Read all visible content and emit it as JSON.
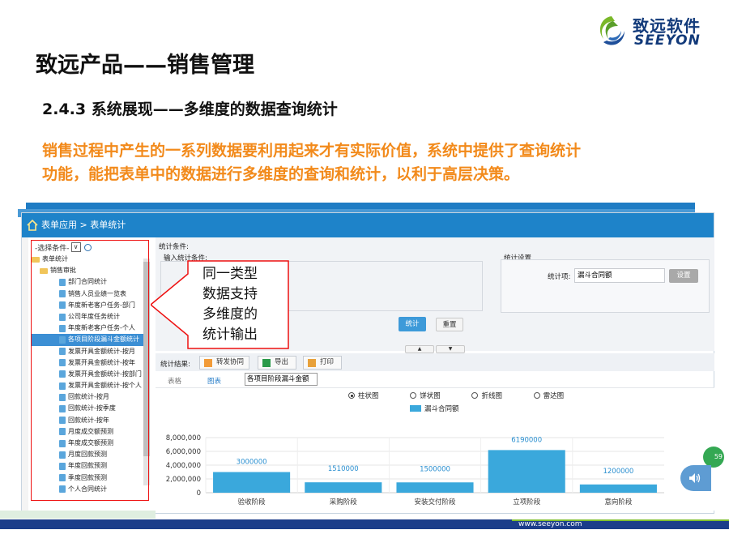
{
  "brand": {
    "cn": "致远软件",
    "en": "SEEYON",
    "url": "www.seeyon.com"
  },
  "slide": {
    "title": "致远产品——销售管理",
    "subtitle": "2.4.3 系统展现——多维度的数据查询统计",
    "desc_line1": "销售过程中产生的一系列数据要利用起来才有实际价值，系统中提供了查询统计",
    "desc_line2": "功能，能把表单中的数据进行多维度的查询和统计，以利于高层决策。"
  },
  "callout": {
    "line1": "同一类型",
    "line2": "数据支持",
    "line3": "多维度的",
    "line4": "统计输出"
  },
  "window": {
    "breadcrumb": "表单应用 > 表单统计",
    "tree": {
      "filter_label": "选择条件",
      "select_value": "∨",
      "root": "表单统计",
      "group": "销售审批",
      "items": [
        "部门合同统计",
        "销售人员业绩一览表",
        "年度新老客户任务-部门",
        "公司年度任务统计",
        "年度新老客户任务-个人",
        "各项目阶段漏斗金额统计",
        "发票开具金额统计-按月",
        "发票开具金额统计-按年",
        "发票开具金额统计-按部门",
        "发票开具金额统计-按个人",
        "回款统计-按月",
        "回款统计-按季度",
        "回款统计-按年",
        "月度成交额预测",
        "年度成交额预测",
        "月度回款预测",
        "年度回款预测",
        "季度回款预测",
        "个人合同统计"
      ]
    },
    "conditions": {
      "title": "统计条件:",
      "input_label": "输入统计条件:",
      "settings_title": "统计设置",
      "stat_item_label": "统计项:",
      "stat_item_value": "漏斗合同额",
      "settings_button": "设置",
      "stat_button": "统计",
      "reset_button": "重置",
      "collapse_up": "▲",
      "collapse_down": "▼"
    },
    "results": {
      "label": "统计结果:",
      "forward_button": "转发协同",
      "export_button": "导出",
      "print_button": "打印",
      "tab_table": "表格",
      "tab_chart": "图表",
      "report_select": "各项目阶段漏斗金额",
      "chart_types": [
        "柱状图",
        "饼状图",
        "折线图",
        "雷达图"
      ],
      "chart_type_selected": "柱状图"
    }
  },
  "badge_text": "59",
  "chart_data": {
    "type": "bar",
    "categories": [
      "验收阶段",
      "采购阶段",
      "安装交付阶段",
      "立项阶段",
      "意向阶段"
    ],
    "series": [
      {
        "name": "漏斗合同额",
        "values": [
          3000000,
          1510000,
          1500000,
          6190000,
          1200000
        ],
        "labels": [
          "3000000",
          "1510000",
          "1500000",
          "6190000",
          "1200000"
        ]
      }
    ],
    "yticks": [
      "0",
      "2,000,000",
      "4,000,000",
      "6,000,000",
      "8,000,000"
    ],
    "ylim": [
      0,
      8000000
    ],
    "legend": "top-center",
    "grid": true,
    "colors": {
      "bar": "#3aa8dc",
      "label": "#2a8fd0"
    }
  }
}
